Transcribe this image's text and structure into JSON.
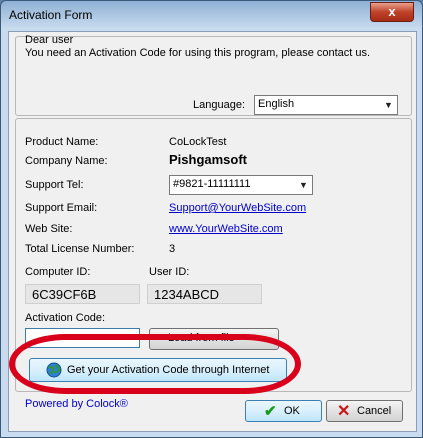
{
  "window": {
    "title": "Activation Form",
    "close_glyph": "x"
  },
  "intro": {
    "greeting": "Dear user",
    "message": "You need an Activation Code for using this program, please contact us."
  },
  "language": {
    "label": "Language:",
    "value": "English"
  },
  "info": {
    "product_name_label": "Product Name:",
    "product_name": "CoLockTest",
    "company_name_label": "Company Name:",
    "company_name": "Pishgamsoft",
    "support_tel_label": "Support Tel:",
    "support_tel": "#9821-11111111",
    "support_email_label": "Support Email:",
    "support_email": "Support@YourWebSite.com",
    "website_label": "Web Site:",
    "website": "www.YourWebSite.com",
    "total_license_label": "Total License Number:",
    "total_license": "3"
  },
  "ids": {
    "computer_id_label": "Computer ID:",
    "computer_id": "6C39CF6B",
    "user_id_label": "User ID:",
    "user_id": "1234ABCD"
  },
  "activation": {
    "label": "Activation Code:",
    "value": "",
    "load_file_label": "Load from file"
  },
  "internet_button": {
    "label": "Get your Activation Code through Internet",
    "icon": "globe-icon"
  },
  "footer": {
    "powered_by": "Powered by Colock®",
    "ok_label": "OK",
    "cancel_label": "Cancel"
  },
  "colors": {
    "highlight_ring": "#d8001b",
    "link": "#0000c8",
    "ok_check": "#1a9a1a",
    "cancel_x": "#c81414"
  }
}
